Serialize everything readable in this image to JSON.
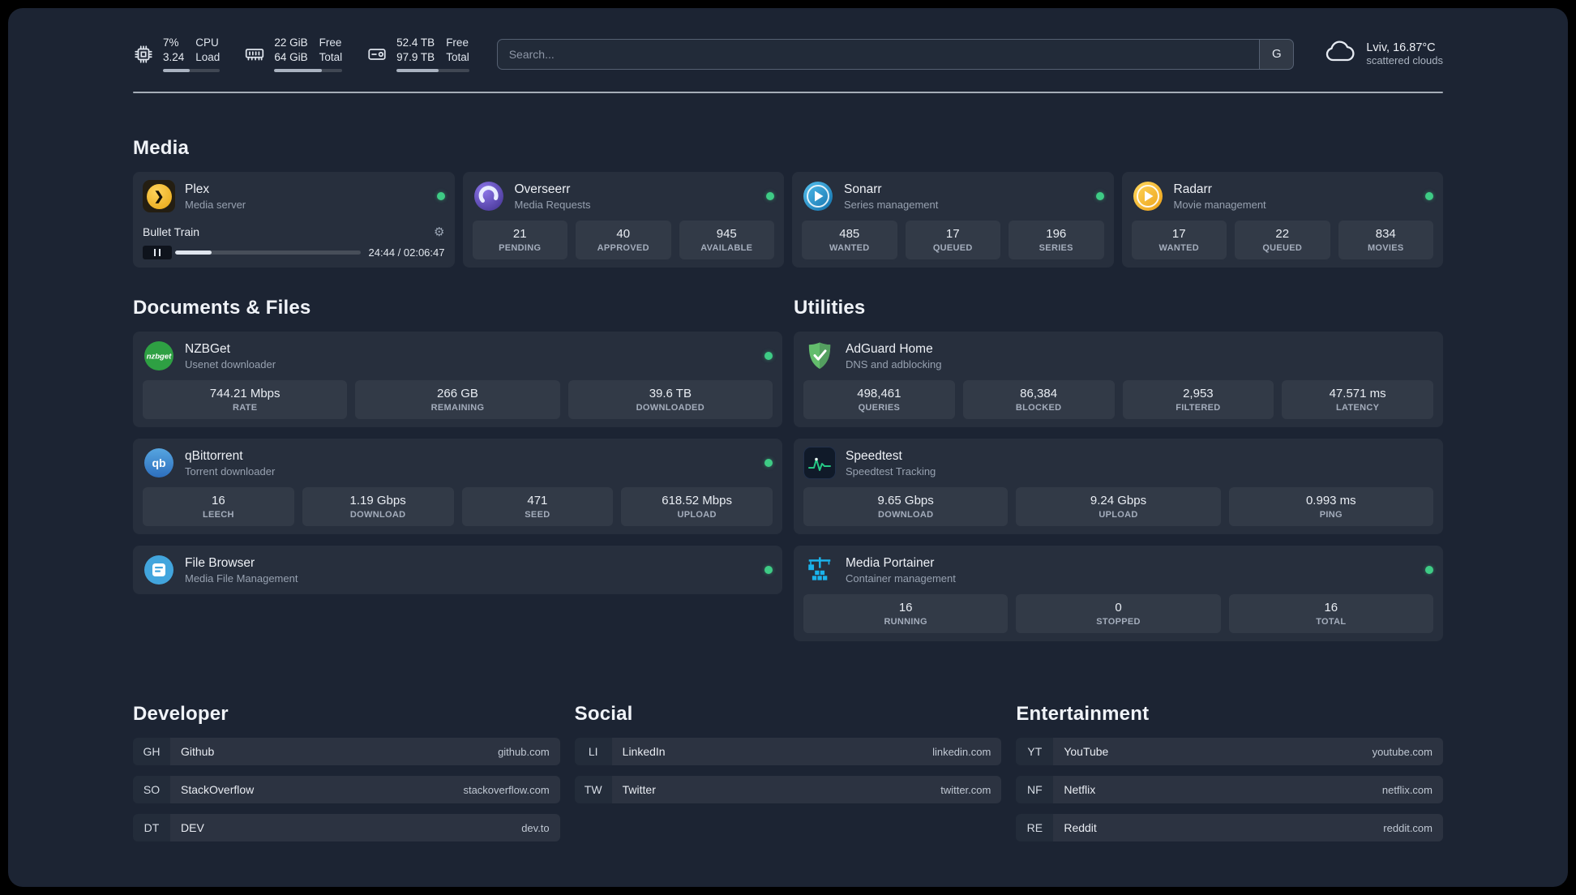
{
  "topbar": {
    "resources": [
      {
        "icon": "cpu-chip-icon",
        "values": [
          "7%",
          "3.24"
        ],
        "labels": [
          "CPU",
          "Load"
        ],
        "progress": 47
      },
      {
        "icon": "memory-icon",
        "values": [
          "22 GiB",
          "64 GiB"
        ],
        "labels": [
          "Free",
          "Total"
        ],
        "progress": 70
      },
      {
        "icon": "disk-icon",
        "values": [
          "52.4 TB",
          "97.9 TB"
        ],
        "labels": [
          "Free",
          "Total"
        ],
        "progress": 58
      }
    ],
    "search": {
      "placeholder": "Search...",
      "button": "G"
    },
    "weather": {
      "icon": "cloud-icon",
      "line1": "Lviv, 16.87°C",
      "line2": "scattered clouds"
    }
  },
  "sections": {
    "media": {
      "title": "Media",
      "services": [
        {
          "id": "plex",
          "icon": "plex-icon",
          "name": "Plex",
          "subtitle": "Media server",
          "online": true,
          "player": {
            "track": "Bullet Train",
            "time": "24:44 / 02:06:47",
            "progress": 19.5
          }
        },
        {
          "id": "overseerr",
          "icon": "overseerr-icon",
          "name": "Overseerr",
          "subtitle": "Media Requests",
          "online": true,
          "stats": [
            {
              "value": "21",
              "label": "PENDING"
            },
            {
              "value": "40",
              "label": "APPROVED"
            },
            {
              "value": "945",
              "label": "AVAILABLE"
            }
          ]
        },
        {
          "id": "sonarr",
          "icon": "sonarr-icon",
          "name": "Sonarr",
          "subtitle": "Series management",
          "online": true,
          "stats": [
            {
              "value": "485",
              "label": "WANTED"
            },
            {
              "value": "17",
              "label": "QUEUED"
            },
            {
              "value": "196",
              "label": "SERIES"
            }
          ]
        },
        {
          "id": "radarr",
          "icon": "radarr-icon",
          "name": "Radarr",
          "subtitle": "Movie management",
          "online": true,
          "stats": [
            {
              "value": "17",
              "label": "WANTED"
            },
            {
              "value": "22",
              "label": "QUEUED"
            },
            {
              "value": "834",
              "label": "MOVIES"
            }
          ]
        }
      ]
    },
    "documents": {
      "title": "Documents & Files",
      "services": [
        {
          "id": "nzbget",
          "icon": "nzbget-icon",
          "name": "NZBGet",
          "subtitle": "Usenet downloader",
          "online": true,
          "stats": [
            {
              "value": "744.21 Mbps",
              "label": "RATE"
            },
            {
              "value": "266 GB",
              "label": "REMAINING"
            },
            {
              "value": "39.6 TB",
              "label": "DOWNLOADED"
            }
          ]
        },
        {
          "id": "qbittorrent",
          "icon": "qbittorrent-icon",
          "name": "qBittorrent",
          "subtitle": "Torrent downloader",
          "online": true,
          "stats": [
            {
              "value": "16",
              "label": "LEECH"
            },
            {
              "value": "1.19 Gbps",
              "label": "DOWNLOAD"
            },
            {
              "value": "471",
              "label": "SEED"
            },
            {
              "value": "618.52 Mbps",
              "label": "UPLOAD"
            }
          ]
        },
        {
          "id": "filebrowser",
          "icon": "filebrowser-icon",
          "name": "File Browser",
          "subtitle": "Media File Management",
          "online": true
        }
      ]
    },
    "utilities": {
      "title": "Utilities",
      "services": [
        {
          "id": "adguard",
          "icon": "adguard-icon",
          "name": "AdGuard Home",
          "subtitle": "DNS and adblocking",
          "online": false,
          "stats": [
            {
              "value": "498,461",
              "label": "QUERIES"
            },
            {
              "value": "86,384",
              "label": "BLOCKED"
            },
            {
              "value": "2,953",
              "label": "FILTERED"
            },
            {
              "value": "47.571 ms",
              "label": "LATENCY"
            }
          ]
        },
        {
          "id": "speedtest",
          "icon": "speedtest-icon",
          "name": "Speedtest",
          "subtitle": "Speedtest Tracking",
          "online": false,
          "stats": [
            {
              "value": "9.65 Gbps",
              "label": "DOWNLOAD"
            },
            {
              "value": "9.24 Gbps",
              "label": "UPLOAD"
            },
            {
              "value": "0.993 ms",
              "label": "PING"
            }
          ]
        },
        {
          "id": "portainer",
          "icon": "portainer-icon",
          "name": "Media Portainer",
          "subtitle": "Container management",
          "online": true,
          "stats": [
            {
              "value": "16",
              "label": "RUNNING"
            },
            {
              "value": "0",
              "label": "STOPPED"
            },
            {
              "value": "16",
              "label": "TOTAL"
            }
          ]
        }
      ]
    }
  },
  "bookmarks": [
    {
      "title": "Developer",
      "items": [
        {
          "abbr": "GH",
          "name": "Github",
          "domain": "github.com"
        },
        {
          "abbr": "SO",
          "name": "StackOverflow",
          "domain": "stackoverflow.com"
        },
        {
          "abbr": "DT",
          "name": "DEV",
          "domain": "dev.to"
        }
      ]
    },
    {
      "title": "Social",
      "items": [
        {
          "abbr": "LI",
          "name": "LinkedIn",
          "domain": "linkedin.com"
        },
        {
          "abbr": "TW",
          "name": "Twitter",
          "domain": "twitter.com"
        }
      ]
    },
    {
      "title": "Entertainment",
      "items": [
        {
          "abbr": "YT",
          "name": "YouTube",
          "domain": "youtube.com"
        },
        {
          "abbr": "NF",
          "name": "Netflix",
          "domain": "netflix.com"
        },
        {
          "abbr": "RE",
          "name": "Reddit",
          "domain": "reddit.com"
        }
      ]
    }
  ]
}
